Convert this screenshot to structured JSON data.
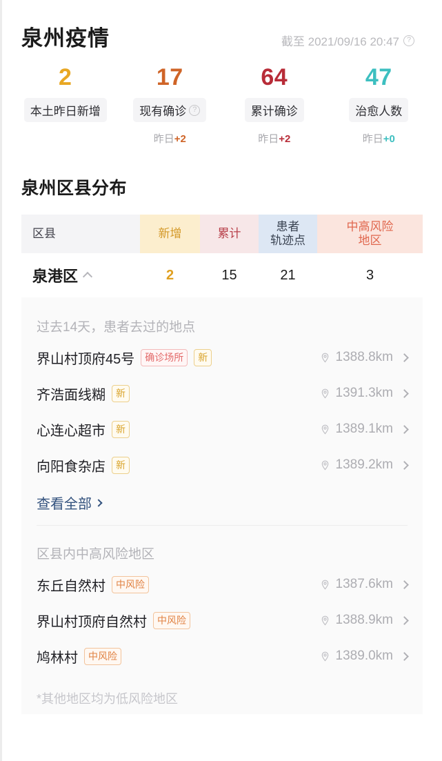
{
  "header": {
    "title": "泉州疫情",
    "timestamp": "截至 2021/09/16 20:47",
    "help_icon": "question-circle-icon"
  },
  "stats": [
    {
      "value": "2",
      "color": "#e8a723",
      "label": "本土昨日新增",
      "has_help": false,
      "delta_prefix": "",
      "delta_value": "",
      "delta_color": "#cf6427",
      "show_delta": false
    },
    {
      "value": "17",
      "color": "#cf6427",
      "label": "现有确诊",
      "has_help": true,
      "delta_prefix": "昨日",
      "delta_value": "+2",
      "delta_color": "#cf6427",
      "show_delta": true
    },
    {
      "value": "64",
      "color": "#b82c38",
      "label": "累计确诊",
      "has_help": false,
      "delta_prefix": "昨日",
      "delta_value": "+2",
      "delta_color": "#b82c38",
      "show_delta": true
    },
    {
      "value": "47",
      "color": "#3dbfc0",
      "label": "治愈人数",
      "has_help": false,
      "delta_prefix": "昨日",
      "delta_value": "+0",
      "delta_color": "#3dbfc0",
      "show_delta": true
    }
  ],
  "section": {
    "title": "泉州区县分布"
  },
  "table": {
    "headers": {
      "region": "区县",
      "new": "新增",
      "total": "累计",
      "track_line1": "患者",
      "track_line2": "轨迹点",
      "risk_line1": "中高风险",
      "risk_line2": "地区"
    },
    "row": {
      "region": "泉港区",
      "expanded": true,
      "new": "2",
      "total": "15",
      "track": "21",
      "risk": "3"
    }
  },
  "panel": {
    "visited_header": "过去14天，患者去过的地点",
    "visited": [
      {
        "name": "界山村顶府45号",
        "badges": [
          "确诊场所",
          "新"
        ],
        "distance": "1388.8km"
      },
      {
        "name": "齐浩面线糊",
        "badges": [
          "新"
        ],
        "distance": "1391.3km"
      },
      {
        "name": "心连心超市",
        "badges": [
          "新"
        ],
        "distance": "1389.1km"
      },
      {
        "name": "向阳食杂店",
        "badges": [
          "新"
        ],
        "distance": "1389.2km"
      }
    ],
    "see_all": "查看全部",
    "risk_header": "区县内中高风险地区",
    "risk_areas": [
      {
        "name": "东丘自然村",
        "badge": "中风险",
        "distance": "1387.6km"
      },
      {
        "name": "界山村顶府自然村",
        "badge": "中风险",
        "distance": "1388.9km"
      },
      {
        "name": "鸠林村",
        "badge": "中风险",
        "distance": "1389.0km"
      }
    ],
    "footnote": "*其他地区均为低风险地区"
  }
}
